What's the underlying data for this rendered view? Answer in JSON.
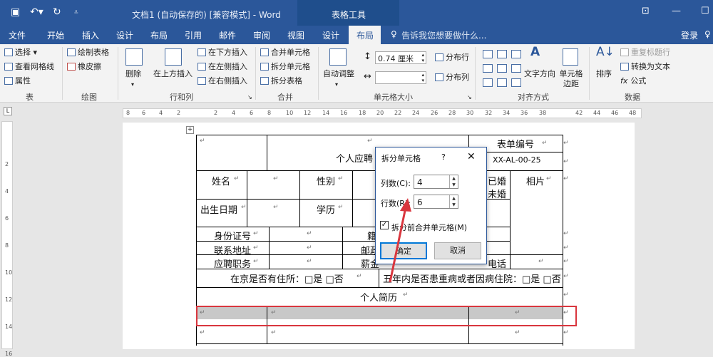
{
  "title_bar": {
    "save_icon": "save-icon",
    "undo_icon": "undo-icon",
    "redo_icon": "redo-icon",
    "customize_icon": "customize-qat-icon",
    "doc_title": "文档1 (自动保存的) [兼容模式] - Word",
    "context_label": "表格工具",
    "restore_icon": "restore-icon",
    "minimize": "—",
    "maximize": "☐"
  },
  "tabs": [
    "文件",
    "开始",
    "插入",
    "设计",
    "布局",
    "引用",
    "邮件",
    "审阅",
    "视图",
    "设计",
    "布局"
  ],
  "tell_me": "告诉我您想要做什么...",
  "login": "登录",
  "ribbon": {
    "table": {
      "select": "选择",
      "gridlines": "查看网格线",
      "properties": "属性",
      "group": "表"
    },
    "draw": {
      "draw_table": "绘制表格",
      "eraser": "橡皮擦",
      "group": "绘图"
    },
    "rows_cols": {
      "delete": "删除",
      "insert_above": "在上方插入",
      "insert_below": "在下方插入",
      "insert_left": "在左侧插入",
      "insert_right": "在右侧插入",
      "group": "行和列"
    },
    "merge": {
      "merge_cells": "合并单元格",
      "split_cells": "拆分单元格",
      "split_table": "拆分表格",
      "group": "合并"
    },
    "cell_size": {
      "autofit": "自动调整",
      "height_value": "0.74 厘米",
      "width_value": "",
      "distribute_rows": "分布行",
      "distribute_cols": "分布列",
      "group": "单元格大小"
    },
    "alignment": {
      "text_direction": "文字方向",
      "cell_margins": "单元格边距",
      "group": "对齐方式"
    },
    "data": {
      "sort": "排序",
      "repeat_header": "重复标题行",
      "convert_text": "转换为文本",
      "formula": "公式",
      "group": "数据"
    }
  },
  "ruler_ticks": [
    "8",
    "6",
    "4",
    "2",
    "2",
    "4",
    "6",
    "8",
    "10",
    "12",
    "14",
    "16",
    "18",
    "20",
    "22",
    "24",
    "26",
    "28",
    "30",
    "32",
    "34",
    "36",
    "38",
    "42",
    "44",
    "46",
    "48"
  ],
  "vruler_ticks": [
    "2",
    "4",
    "6",
    "8",
    "10",
    "12",
    "14",
    "16"
  ],
  "doc": {
    "form_title": "个人应聘",
    "form_no_label": "表单编号",
    "form_no_value": "XX-AL-00-25",
    "name": "姓名",
    "gender": "性别",
    "married": "已婚",
    "unmarried": "未婚",
    "photo": "相片",
    "birth": "出生日期",
    "education": "学历",
    "id_no": "身份证号",
    "native": "籍",
    "address": "联系地址",
    "postal": "邮政",
    "position": "应聘职务",
    "salary": "薪金",
    "phone": "电话",
    "residence": "在京是否有住所：□是 □否",
    "illness": "五年内是否患重病或者因病住院：□是 □否",
    "resume": "个人简历",
    "para_mark": "↵"
  },
  "dialog": {
    "title": "拆分单元格",
    "help": "?",
    "close": "✕",
    "cols_label": "列数(C):",
    "cols_value": "4",
    "rows_label": "行数(R):",
    "rows_value": "6",
    "merge_before_split": "拆分前合并单元格(M)",
    "ok": "确定",
    "cancel": "取消"
  },
  "colors": {
    "title_bar": "#2b579a",
    "highlight_box": "#d9363e",
    "selected_row": "#c8c8c8"
  }
}
